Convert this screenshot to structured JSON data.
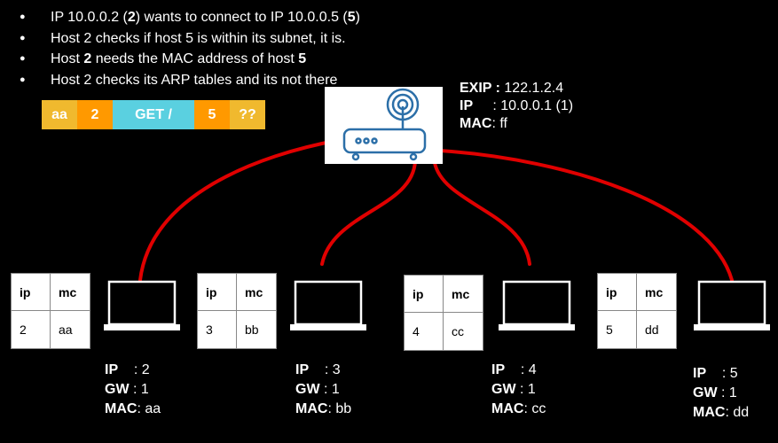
{
  "bullets": [
    {
      "t1": "IP 10.0.0.2 (",
      "b1": "2",
      "t2": ")  wants to connect to  IP 10.0.0.5 (",
      "b2": "5",
      "t3": ")"
    },
    {
      "t1": "Host 2 checks if host 5 is within its subnet, it is."
    },
    {
      "t1": "Host ",
      "b1": "2",
      "t2": " needs the MAC address of host ",
      "b2": "5"
    },
    {
      "t1": "Host 2 checks its ARP tables and its not there"
    }
  ],
  "packet": [
    {
      "text": "aa",
      "color": "#f0b92e"
    },
    {
      "text": "2",
      "color": "#ff9900"
    },
    {
      "text": "GET /",
      "color": "#5ad0e0"
    },
    {
      "text": "5",
      "color": "#ff9900"
    },
    {
      "text": "??",
      "color": "#f0b92e"
    }
  ],
  "router": {
    "icon": "router-icon",
    "exip_label": "EXIP :",
    "exip_value": " 122.1.2.4",
    "ip_label": "IP",
    "ip_value": "     : 10.0.0.1 (1)",
    "mac_label": "MAC",
    "mac_value": ": ff"
  },
  "table_headers": {
    "ip": "ip",
    "mac": "mc"
  },
  "hosts": [
    {
      "ip": "2",
      "mac": "aa",
      "ip_label": "IP",
      "ip_value": "    : 2",
      "gw_label": "GW",
      "gw_value": " :  1",
      "mac_label": "MAC",
      "mac_value": ": aa"
    },
    {
      "ip": "3",
      "mac": "bb",
      "ip_label": "IP",
      "ip_value": "    : 3",
      "gw_label": "GW",
      "gw_value": " :  1",
      "mac_label": "MAC",
      "mac_value": ": bb"
    },
    {
      "ip": "4",
      "mac": "cc",
      "ip_label": "IP",
      "ip_value": "    : 4",
      "gw_label": "GW",
      "gw_value": " :  1",
      "mac_label": "MAC",
      "mac_value": ": cc"
    },
    {
      "ip": "5",
      "mac": "dd",
      "ip_label": "IP",
      "ip_value": "    : 5",
      "gw_label": "GW",
      "gw_value": " :  1",
      "mac_label": "MAC",
      "mac_value": ": dd"
    }
  ],
  "colors": {
    "wire": "#e00000",
    "background": "#000000"
  }
}
